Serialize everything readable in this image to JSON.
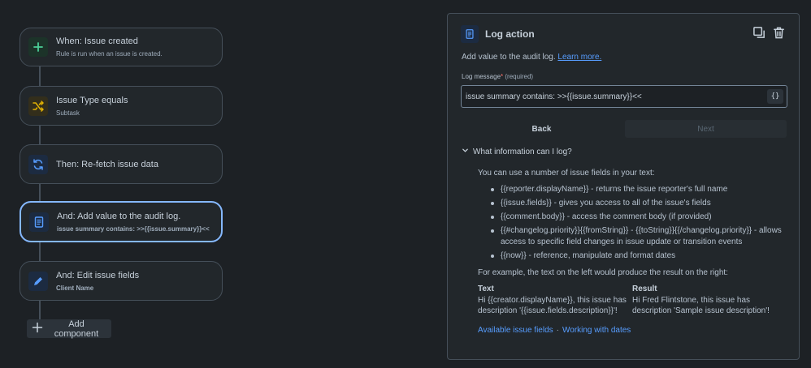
{
  "flow": {
    "nodes": [
      {
        "title": "When: Issue created",
        "subtitle": "Rule is run when an issue is created.",
        "icon": "plus-icon",
        "color": "#4bce97",
        "bg": "#1c3329"
      },
      {
        "title": "Issue Type equals",
        "subtitle": "Subtask",
        "icon": "shuffle-icon",
        "color": "#e2b203",
        "bg": "#332e1b"
      },
      {
        "title": "Then: Re-fetch issue data",
        "subtitle": "",
        "icon": "refresh-icon",
        "color": "#579dff",
        "bg": "#1c2b41"
      },
      {
        "title": "And: Add value to the audit log.",
        "subtitle": "issue summary contains: >>{{issue.summary}}<<",
        "icon": "document-icon",
        "color": "#579dff",
        "bg": "#1c2b41"
      },
      {
        "title": "And: Edit issue fields",
        "subtitle": "Client Name",
        "icon": "pencil-icon",
        "color": "#579dff",
        "bg": "#1c2b41"
      }
    ],
    "add_component_label": "Add component"
  },
  "panel": {
    "title": "Log action",
    "description": "Add value to the audit log.",
    "learn_more": "Learn more.",
    "field_label": "Log message",
    "required_mark": "*",
    "required_hint": "(required)",
    "field_value": "issue summary contains: >>{{issue.summary}}<<",
    "smart_value_button": "{}",
    "back_label": "Back",
    "next_label": "Next",
    "toggle_label": "What information can I log?",
    "info_intro": "You can use a number of issue fields in your text:",
    "info_items": [
      "{{reporter.displayName}} - returns the issue reporter's full name",
      "{{issue.fields}} - gives you access to all of the issue's fields",
      "{{comment.body}} - access the comment body (if provided)",
      "{{#changelog.priority}}{{fromString}} - {{toString}}{{/changelog.priority}} - allows access to specific field changes in issue update or transition events",
      "{{now}} - reference, manipulate and format dates"
    ],
    "example_intro": "For example, the text on the left would produce the result on the right:",
    "text_heading": "Text",
    "text_value": "Hi {{creator.displayName}}, this issue has description '{{issue.fields.description}}'!",
    "result_heading": "Result",
    "result_value": "Hi Fred Flintstone, this issue has description 'Sample issue description'!",
    "link_fields": "Available issue fields",
    "link_separator": "·",
    "link_dates": "Working with dates"
  },
  "colors": {
    "background": "#1d2125",
    "surface": "#22272b",
    "border": "#454f59",
    "selected_border": "#85b8ff",
    "link": "#579dff"
  }
}
